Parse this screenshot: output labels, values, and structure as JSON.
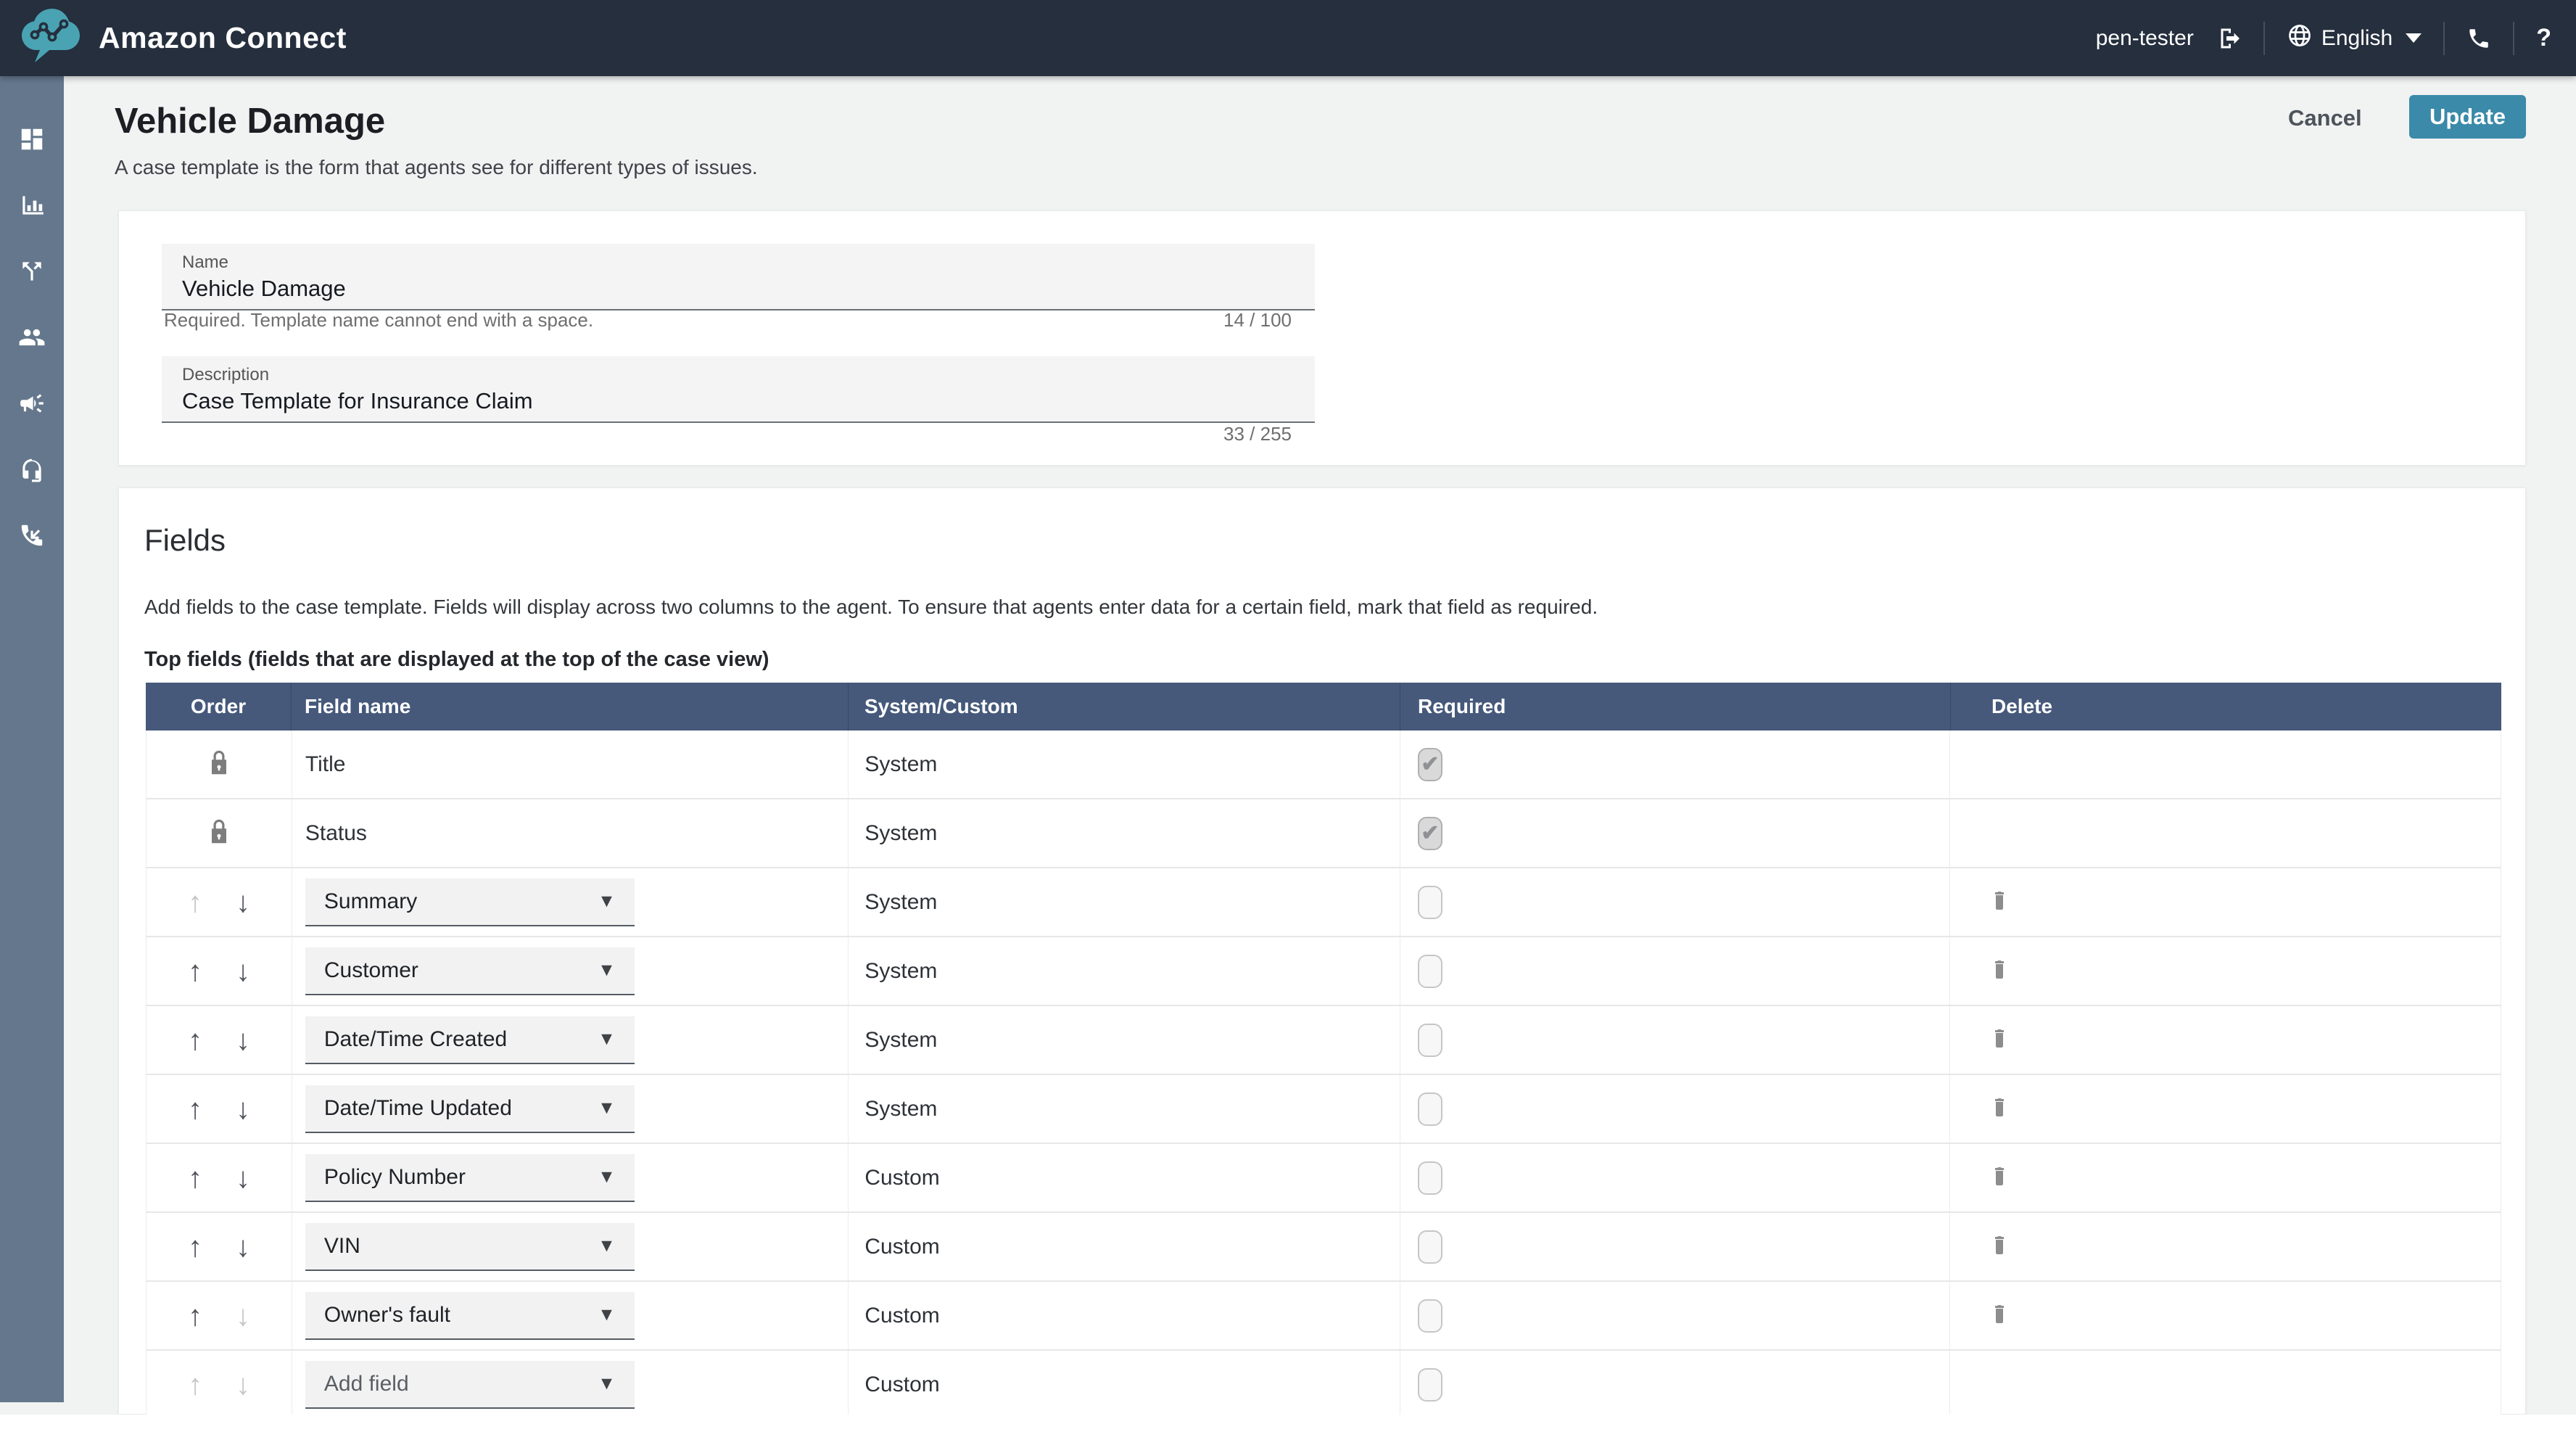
{
  "header": {
    "brand": "Amazon Connect",
    "user": "pen-tester",
    "language": "English",
    "help_label": "?"
  },
  "page": {
    "title": "Vehicle Damage",
    "subtitle": "A case template is the form that agents see for different types of issues.",
    "cancel_label": "Cancel",
    "update_label": "Update"
  },
  "form": {
    "name": {
      "label": "Name",
      "value": "Vehicle Damage",
      "helper": "Required. Template name cannot end with a space.",
      "counter": "14 / 100"
    },
    "description": {
      "label": "Description",
      "value": "Case Template for Insurance Claim",
      "counter": "33 / 255"
    }
  },
  "fields_section": {
    "title": "Fields",
    "description": "Add fields to the case template. Fields will display across two columns to the agent. To ensure that agents enter data for a certain field, mark that field as required.",
    "top_fields_label": "Top fields (fields that are displayed at the top of the case view)",
    "table": {
      "columns": [
        "Order",
        "Field name",
        "System/Custom",
        "Required",
        "Delete"
      ],
      "rows": [
        {
          "order": "locked",
          "name": "Title",
          "control": "static",
          "system_custom": "System",
          "required": "checked-disabled",
          "deletable": false
        },
        {
          "order": "locked",
          "name": "Status",
          "control": "static",
          "system_custom": "System",
          "required": "checked-disabled",
          "deletable": false
        },
        {
          "order": "movable",
          "up_enabled": false,
          "down_enabled": true,
          "name": "Summary",
          "control": "select",
          "system_custom": "System",
          "required": "unchecked",
          "deletable": true
        },
        {
          "order": "movable",
          "up_enabled": true,
          "down_enabled": true,
          "name": "Customer",
          "control": "select",
          "system_custom": "System",
          "required": "unchecked",
          "deletable": true
        },
        {
          "order": "movable",
          "up_enabled": true,
          "down_enabled": true,
          "name": "Date/Time Created",
          "control": "select",
          "system_custom": "System",
          "required": "unchecked",
          "deletable": true
        },
        {
          "order": "movable",
          "up_enabled": true,
          "down_enabled": true,
          "name": "Date/Time Updated",
          "control": "select",
          "system_custom": "System",
          "required": "unchecked",
          "deletable": true
        },
        {
          "order": "movable",
          "up_enabled": true,
          "down_enabled": true,
          "name": "Policy Number",
          "control": "select",
          "system_custom": "Custom",
          "required": "unchecked",
          "deletable": true
        },
        {
          "order": "movable",
          "up_enabled": true,
          "down_enabled": true,
          "name": "VIN",
          "control": "select",
          "system_custom": "Custom",
          "required": "unchecked",
          "deletable": true
        },
        {
          "order": "movable",
          "up_enabled": true,
          "down_enabled": false,
          "name": "Owner's fault",
          "control": "select",
          "system_custom": "Custom",
          "required": "unchecked",
          "deletable": true
        },
        {
          "order": "movable",
          "up_enabled": false,
          "down_enabled": false,
          "name": "Add field",
          "control": "select-placeholder",
          "system_custom": "Custom",
          "required": "unchecked",
          "deletable": false
        }
      ]
    }
  },
  "icons": {
    "up_arrow": "↑",
    "down_arrow": "↓",
    "select_caret": "▼"
  },
  "colors": {
    "header-bg": "#252f3e",
    "sidebar-bg": "#64778c",
    "table-header-bg": "#46597b",
    "accent": "#3b8aa9",
    "page-bg": "#f1f2f2",
    "logo-teal": "#4aa3b2"
  }
}
